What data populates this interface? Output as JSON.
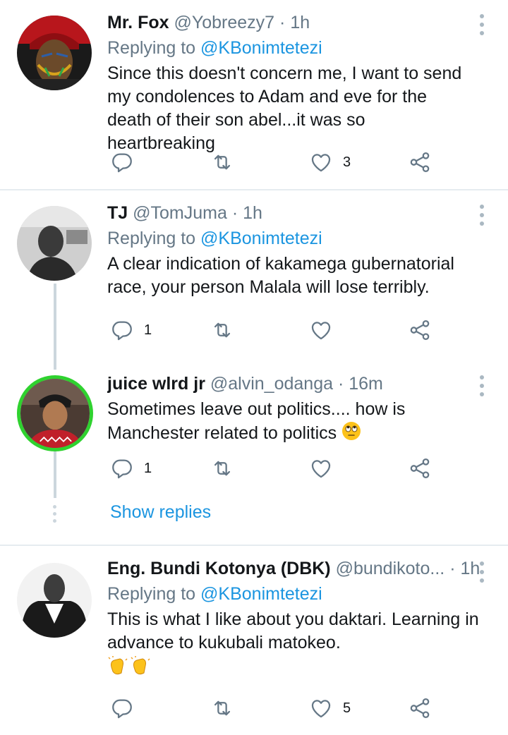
{
  "tweets": [
    {
      "name": "Mr. Fox",
      "handle": "@Yobreezy7",
      "sep": "·",
      "time": "1h",
      "replying_prefix": "Replying to ",
      "replying_to": "@KBonimtetezi",
      "text": "Since this doesn't concern me, I want to send my condolences to Adam and eve for the death of their son abel...it was so heartbreaking",
      "replies": "",
      "likes": "3"
    },
    {
      "name": "TJ",
      "handle": "@TomJuma",
      "sep": "·",
      "time": "1h",
      "replying_prefix": "Replying to ",
      "replying_to": "@KBonimtetezi",
      "text": "A clear indication of kakamega gubernatorial race, your person Malala will lose terribly.",
      "replies": "1",
      "likes": ""
    },
    {
      "name": "juice wlrd jr",
      "handle": "@alvin_odanga",
      "sep": "·",
      "time": "16m",
      "text": "Sometimes leave out politics.... how is Manchester related to politics",
      "emoji": "face-with-rolling-eyes",
      "replies": "1",
      "likes": ""
    },
    {
      "name": "Eng. Bundi Kotonya (DBK)",
      "handle": "@bundikoto...",
      "sep": "·",
      "time": "1h",
      "replying_prefix": "Replying to ",
      "replying_to": "@KBonimtetezi",
      "text": "This is what I like about you daktari.  Learning in advance to kukubali matokeo.",
      "emoji": "clapping-hands",
      "replies": "",
      "likes": "5"
    }
  ],
  "show_replies_label": "Show replies",
  "colors": {
    "link": "#1b95e0",
    "secondary": "#657786",
    "divider": "#e6ecf0",
    "online_ring": "#2fd22f"
  },
  "icons": [
    "reply-icon",
    "retweet-icon",
    "like-icon",
    "share-icon",
    "more-icon"
  ]
}
